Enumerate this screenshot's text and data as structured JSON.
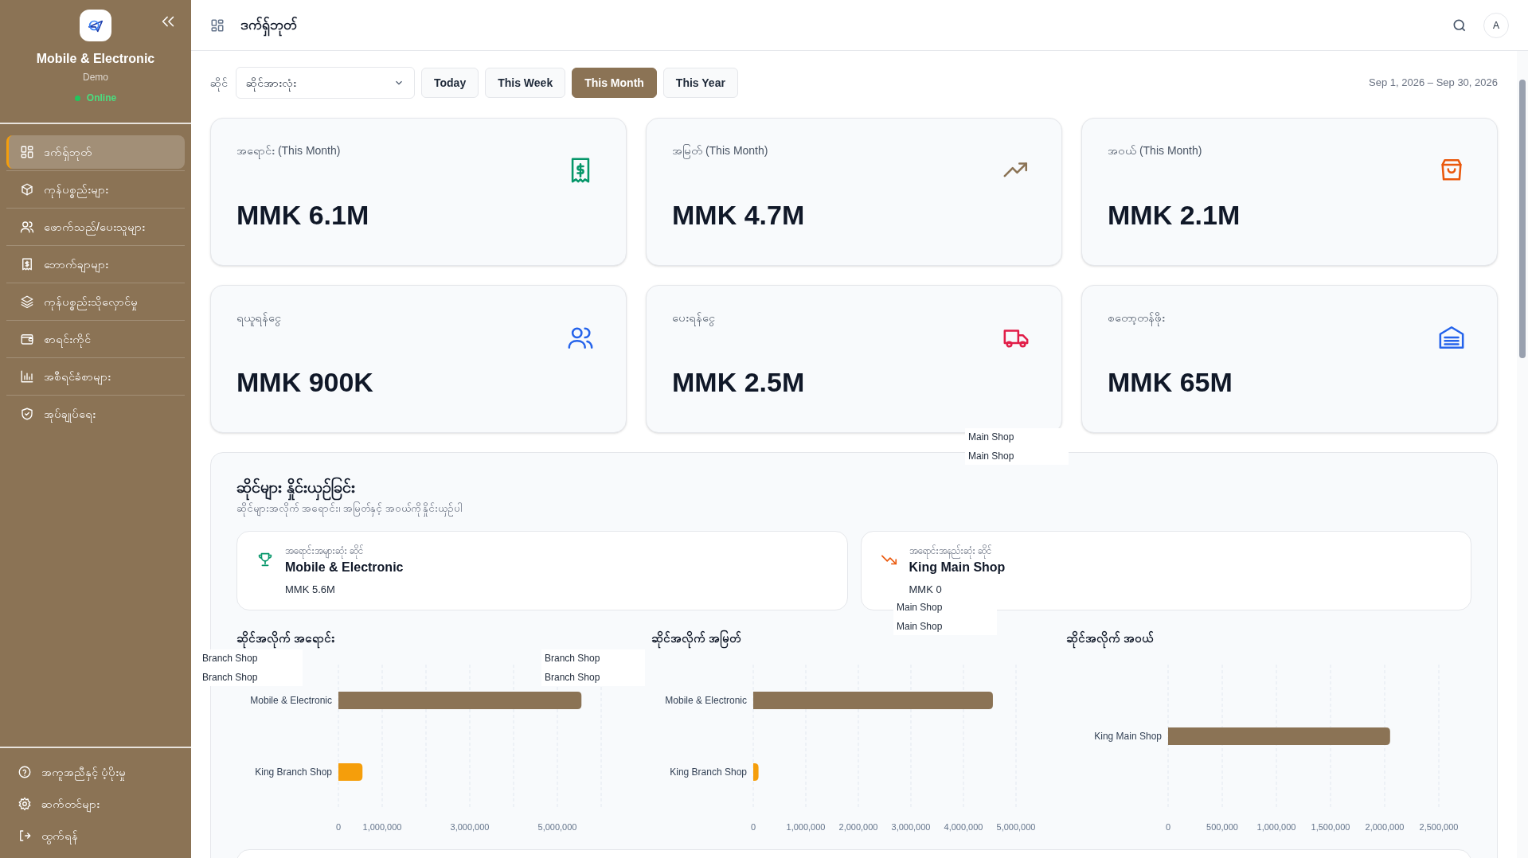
{
  "sidebar": {
    "shop_name": "Mobile & Electronic",
    "subtitle": "Demo",
    "status": "Online",
    "nav": [
      {
        "label": "ဒက်ရှ်ဘုတ်",
        "selected": true
      },
      {
        "label": "ကုန်ပစ္စည်းများ",
        "selected": false
      },
      {
        "label": "ဖောက်သည်/ပေးသူများ",
        "selected": false
      },
      {
        "label": "ဘောက်ချာများ",
        "selected": false
      },
      {
        "label": "ကုန်ပစ္စည်းသိုလှောင်မှု",
        "selected": false
      },
      {
        "label": "စာရင်းကိုင်",
        "selected": false
      },
      {
        "label": "အစီရင်ခံစာများ",
        "selected": false
      },
      {
        "label": "အုပ်ချုပ်ရေး",
        "selected": false
      }
    ],
    "footer": [
      {
        "label": "အကူအညီနှင့် ပံ့ပိုးမှု"
      },
      {
        "label": "ဆက်တင်များ"
      },
      {
        "label": "ထွက်ရန်"
      }
    ]
  },
  "header": {
    "title": "ဒက်ရှ်ဘုတ်",
    "avatar": "A"
  },
  "filters": {
    "shop_label": "ဆိုင်",
    "shop_select": "ဆိုင်အားလုံး",
    "periods": [
      {
        "label": "Today",
        "selected": false
      },
      {
        "label": "This Week",
        "selected": false
      },
      {
        "label": "This Month",
        "selected": true
      },
      {
        "label": "This Year",
        "selected": false
      }
    ],
    "date_range": "Sep 1, 2026 – Sep 30, 2026"
  },
  "stats": [
    {
      "label": "အရောင်း (This Month)",
      "value": "MMK 6.1M"
    },
    {
      "label": "အမြတ် (This Month)",
      "value": "MMK 4.7M"
    },
    {
      "label": "အဝယ် (This Month)",
      "value": "MMK 2.1M"
    },
    {
      "label": "ရယူရန်ငွေ",
      "value": "MMK 900K"
    },
    {
      "label": "ပေးရန်ငွေ",
      "value": "MMK 2.5M"
    },
    {
      "label": "စတော့တန်ဖိုး",
      "value": "MMK 65M"
    }
  ],
  "comparison": {
    "title": "ဆိုင်များ နှိုင်းယှဉ်ခြင်း",
    "subtitle": "ဆိုင်များအလိုက် အရောင်း၊ အမြတ်နှင့် အဝယ်ကို နှိုင်းယှဉ်ပါ",
    "highlights": [
      {
        "kind": "top",
        "label": "အရောင်းအများဆုံး ဆိုင်",
        "name": "Mobile & Electronic",
        "value": "MMK 5.6M"
      },
      {
        "kind": "bottom",
        "label": "အရောင်းအနည်းဆုံး ဆိုင်",
        "name": "King Main Shop",
        "value": "MMK 0"
      }
    ],
    "charts": [
      {
        "chart_data": {
          "type": "bar",
          "orientation": "horizontal",
          "title": "ဆိုင်အလိုက် အရောင်း",
          "grid": true,
          "categories": [
            "Mobile & Electronic",
            "King Branch Shop"
          ],
          "series": [
            {
              "color": "#8b7355",
              "values": [
                5550000,
                null
              ]
            },
            {
              "color": "#f59e0b",
              "values": [
                null,
                550000
              ]
            }
          ],
          "xlim": [
            0,
            6000000
          ],
          "xticks": [
            {
              "value": 0,
              "label": "0"
            },
            {
              "value": 1000000,
              "label": "1,000,000"
            },
            {
              "value": 3000000,
              "label": "3,000,000"
            },
            {
              "value": 5000000,
              "label": "5,000,000"
            }
          ]
        }
      },
      {
        "chart_data": {
          "type": "bar",
          "orientation": "horizontal",
          "title": "ဆိုင်အလိုက် အမြတ်",
          "grid": true,
          "categories": [
            "Mobile & Electronic",
            "King Branch Shop"
          ],
          "series": [
            {
              "color": "#8b7355",
              "values": [
                4560000,
                null
              ]
            },
            {
              "color": "#f59e0b",
              "values": [
                null,
                100000
              ]
            }
          ],
          "xlim": [
            0,
            5000000
          ],
          "xticks": [
            {
              "value": 0,
              "label": "0"
            },
            {
              "value": 1000000,
              "label": "1,000,000"
            },
            {
              "value": 2000000,
              "label": "2,000,000"
            },
            {
              "value": 3000000,
              "label": "3,000,000"
            },
            {
              "value": 4000000,
              "label": "4,000,000"
            },
            {
              "value": 5000000,
              "label": "5,000,000"
            }
          ]
        }
      },
      {
        "chart_data": {
          "type": "bar",
          "orientation": "horizontal",
          "title": "ဆိုင်အလိုက် အဝယ်",
          "grid": true,
          "categories": [
            "King Main Shop"
          ],
          "series": [
            {
              "color": "#8b7355",
              "values": [
                2050000
              ]
            }
          ],
          "xlim": [
            0,
            2500000
          ],
          "xticks": [
            {
              "value": 0,
              "label": "0"
            },
            {
              "value": 500000,
              "label": "500,000"
            },
            {
              "value": 1000000,
              "label": "1,000,000"
            },
            {
              "value": 1500000,
              "label": "1,500,000"
            },
            {
              "value": 2000000,
              "label": "2,000,000"
            },
            {
              "value": 2500000,
              "label": "2,500,000"
            }
          ]
        }
      }
    ]
  },
  "floating_labels": [
    {
      "texts": [
        "Main Shop",
        "Main Shop"
      ]
    },
    {
      "texts": [
        "Main Shop",
        "Main Shop"
      ]
    },
    {
      "texts": [
        "Branch Shop",
        "Branch Shop"
      ]
    },
    {
      "texts": [
        "Branch Shop",
        "Branch Shop"
      ]
    }
  ]
}
